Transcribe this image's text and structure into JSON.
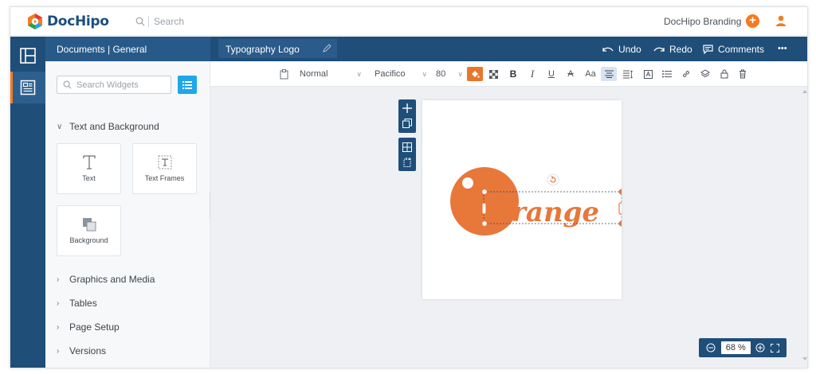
{
  "app": {
    "name": "DocHipo",
    "search_placeholder": "Search",
    "branding_label": "DocHipo Branding",
    "brand_colors": {
      "navy": "#1f4e79",
      "orange": "#f47c20",
      "blue": "#1ea7e9"
    }
  },
  "sidebar": {
    "header": "Documents | General",
    "widget_search_placeholder": "Search Widgets",
    "sections": [
      {
        "label": "Text and Background",
        "expanded": true
      },
      {
        "label": "Graphics and Media",
        "expanded": false
      },
      {
        "label": "Tables",
        "expanded": false
      },
      {
        "label": "Page Setup",
        "expanded": false
      },
      {
        "label": "Versions",
        "expanded": false
      }
    ],
    "widgets": [
      {
        "label": "Text",
        "icon": "text-T-icon"
      },
      {
        "label": "Text Frames",
        "icon": "text-frame-icon"
      },
      {
        "label": "Background",
        "icon": "background-icon"
      }
    ]
  },
  "editor": {
    "doc_name": "Typography Logo",
    "undo_label": "Undo",
    "redo_label": "Redo",
    "comments_label": "Comments",
    "more_label": "•••"
  },
  "toolbar": {
    "style_value": "Normal",
    "font_value": "Pacifico",
    "size_value": "80",
    "bold": "B",
    "italic": "I",
    "underline": "U",
    "strike": "A",
    "case": "Aa"
  },
  "canvas": {
    "logo_text": "range",
    "logo_color": "#e8773a"
  },
  "zoom": {
    "value": "68",
    "unit": "%"
  }
}
